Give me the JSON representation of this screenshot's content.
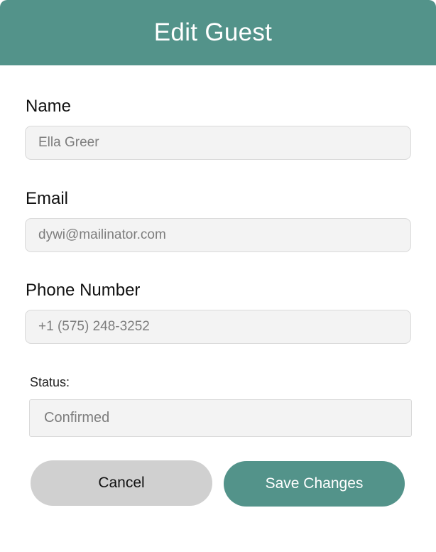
{
  "modal": {
    "title": "Edit Guest"
  },
  "form": {
    "name": {
      "label": "Name",
      "value": "Ella Greer"
    },
    "email": {
      "label": "Email",
      "value": "dywi@mailinator.com"
    },
    "phone": {
      "label": "Phone Number",
      "value": "+1 (575) 248-3252"
    },
    "status": {
      "label": "Status:",
      "selected": "Confirmed"
    }
  },
  "actions": {
    "cancel_label": "Cancel",
    "save_label": "Save Changes"
  },
  "colors": {
    "accent": "#53938a",
    "cancel_bg": "#d0d0d0",
    "input_bg": "#f3f3f3"
  }
}
